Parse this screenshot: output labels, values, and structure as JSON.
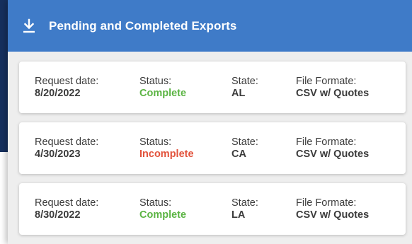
{
  "header": {
    "title": "Pending and Completed Exports",
    "icon": "download-icon"
  },
  "labels": {
    "request_date": "Request date:",
    "status": "Status:",
    "state": "State:",
    "file_format": "File Formate:"
  },
  "exports": [
    {
      "request_date": "8/20/2022",
      "status": "Complete",
      "state": "AL",
      "file_format": "CSV w/ Quotes"
    },
    {
      "request_date": "4/30/2023",
      "status": "Incomplete",
      "state": "CA",
      "file_format": "CSV w/ Quotes"
    },
    {
      "request_date": "8/30/2022",
      "status": "Complete",
      "state": "LA",
      "file_format": "CSV w/ Quotes"
    }
  ],
  "colors": {
    "header_bg": "#3f7bc8",
    "complete": "#5bb443",
    "incomplete": "#e2523b"
  }
}
